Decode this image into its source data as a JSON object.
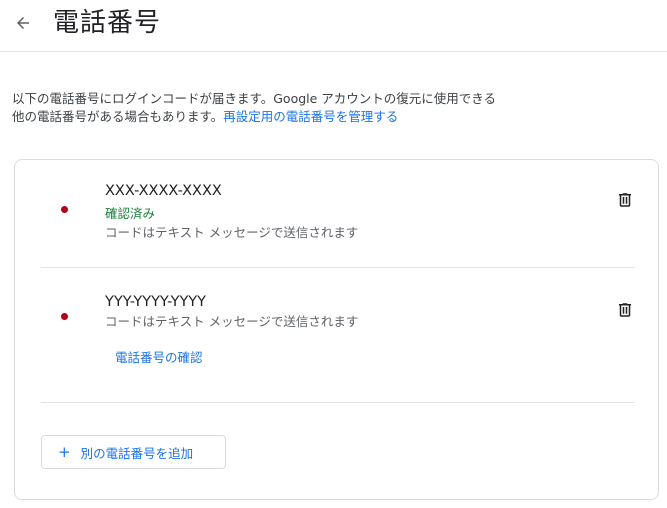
{
  "header": {
    "back_icon": "arrow-left-icon",
    "title": "電話番号"
  },
  "intro": {
    "text_line1": "以下の電話番号にログインコードが届きます。Google アカウントの復元に使用できる",
    "text_line2": "他の電話番号がある場合もあります。",
    "manage_link": "再設定用の電話番号を管理する"
  },
  "phones": [
    {
      "number": "XXX-XXXX-XXXX",
      "status": "確認済み",
      "description": "コードはテキスト メッセージで送信されます",
      "delete_icon": "trash-icon"
    },
    {
      "number": "YYY-YYYY-YYYY",
      "description": "コードはテキスト メッセージで送信されます",
      "verify_link": "電話番号の確認",
      "delete_icon": "trash-icon"
    }
  ],
  "add_button": {
    "icon": "plus-icon",
    "label": "別の電話番号を追加"
  },
  "colors": {
    "accent": "#1a73e8",
    "verified": "#188038",
    "dot": "#b3001b"
  }
}
